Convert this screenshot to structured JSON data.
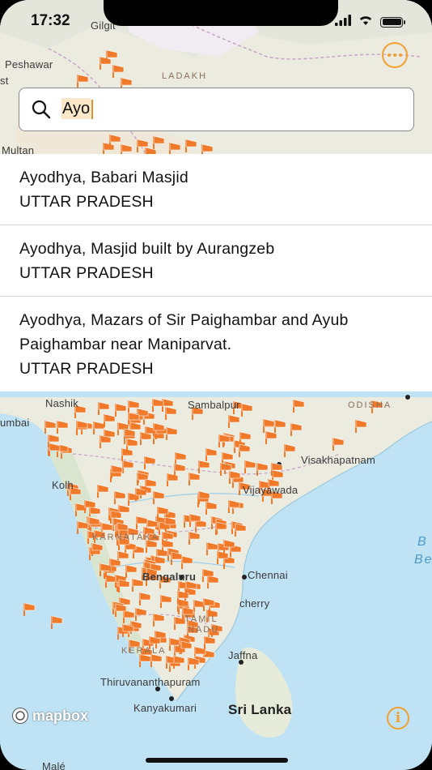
{
  "status_bar": {
    "time": "17:32"
  },
  "search": {
    "value": "Ayo",
    "placeholder": ""
  },
  "results": [
    {
      "name": "Ayodhya, Babari Masjid",
      "state": "UTTAR PRADESH"
    },
    {
      "name": "Ayodhya, Masjid built by Aurangzeb",
      "state": "UTTAR PRADESH"
    },
    {
      "name": "Ayodhya, Mazars of Sir Paighambar and Ayub Paighambar near Maniparvat.",
      "state": "UTTAR PRADESH"
    }
  ],
  "map": {
    "labels_top": {
      "gilgit": "Gilgit",
      "peshawar": "Peshawar",
      "ladakh": "LADAKH",
      "multan": "Multan",
      "st": "st"
    },
    "labels_bottom": {
      "nashik": "Nashik",
      "mumbai": "umbai",
      "odisha": "ODISHA",
      "sambalpur": "Sambalpur",
      "visakhapatnam": "Visakhapatnam",
      "kolhapur": "Kolh",
      "vijayawada": "Vijayawada",
      "karnataka": "KARNATAKA",
      "bengaluru": "Bengaluru",
      "chennai": "Chennai",
      "puducherry": "cherry",
      "tamil": "TAMIL",
      "nadu": "NADU",
      "kerala": "KERALA",
      "jaffna": "Jaffna",
      "thiruvananthapuram": "Thiruvananthapuram",
      "kanyakumari": "Kanyakumari",
      "sri_lanka": "Sri Lanka",
      "male": "Malé",
      "bay_b": "B",
      "bay_be": "Be"
    },
    "attribution": "mapbox",
    "marker_color": "#f07a2a"
  },
  "buttons": {
    "more_icon": "ellipsis-icon",
    "info_icon": "info-icon",
    "info_label": "i"
  }
}
